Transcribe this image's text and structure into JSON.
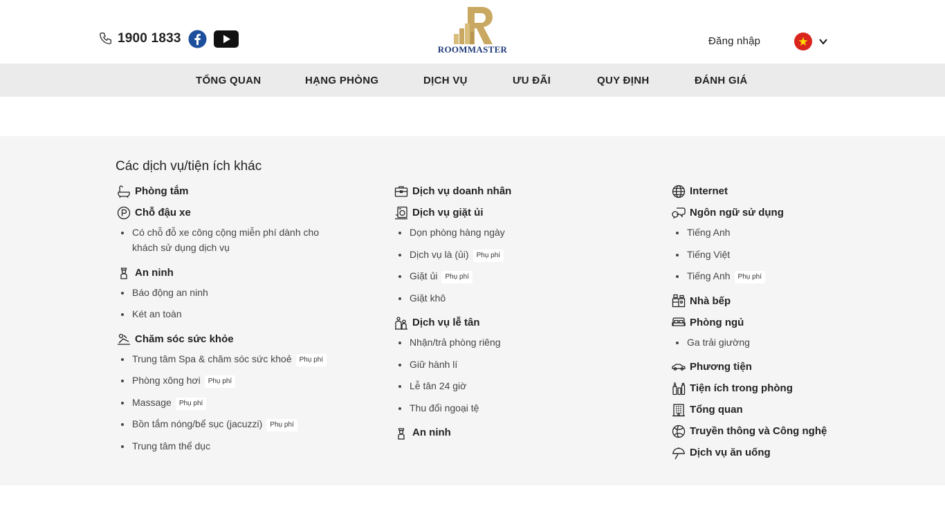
{
  "header": {
    "phone": "1900 1833",
    "brand": "ROOMMASTER",
    "login_label": "Đăng nhập",
    "language_icon": "vietnam-flag-icon",
    "brand_color": "#c9a961",
    "logo_text_color": "#1e3a78"
  },
  "nav": {
    "items": [
      {
        "label": "TỔNG QUAN"
      },
      {
        "label": "HẠNG PHÒNG"
      },
      {
        "label": "DỊCH VỤ"
      },
      {
        "label": "ƯU ĐÃI"
      },
      {
        "label": "QUY ĐỊNH"
      },
      {
        "label": "ĐÁNH GIÁ"
      }
    ]
  },
  "amenities": {
    "title": "Các dịch vụ/tiện ích khác",
    "fee_badge": "Phụ phí",
    "col1": {
      "bathroom": "Phòng tắm",
      "parking": "Chỗ đậu xe",
      "parking_items": [
        "Có chỗ đỗ xe công cộng miễn phí dành cho khách sử dụng dịch vụ"
      ],
      "security": "An ninh",
      "security_items": [
        "Báo động an ninh",
        "Két an toàn"
      ],
      "health": "Chăm sóc sức khỏe",
      "health_items": [
        "Trung tâm Spa & chăm sóc sức khoẻ",
        "Phòng xông hơi",
        "Massage",
        "Bồn tắm nóng/bể sục (jacuzzi)",
        "Trung tâm thể dục"
      ]
    },
    "col2": {
      "business": "Dịch vụ doanh nhân",
      "laundry": "Dịch vụ giặt ủi",
      "laundry_items": [
        "Dọn phòng hàng ngày",
        "Dịch vụ là (ủi)",
        "Giặt ủi",
        "Giặt khô"
      ],
      "reception": "Dịch vụ lễ tân",
      "reception_items": [
        "Nhận/trả phòng riêng",
        "Giữ hành lí",
        "Lễ tân 24 giờ",
        "Thu đổi ngoại tệ"
      ],
      "security": "An ninh"
    },
    "col3": {
      "internet": "Internet",
      "languages": "Ngôn ngữ sử dụng",
      "language_items": [
        "Tiếng Anh",
        "Tiếng Việt",
        "Tiếng Anh"
      ],
      "kitchen": "Nhà bếp",
      "bedroom": "Phòng ngủ",
      "bedroom_items": [
        "Ga trải giường"
      ],
      "transport": "Phương tiện",
      "room_amenities": "Tiện ích trong phòng",
      "overview": "Tổng quan",
      "media": "Truyền thông và Công nghệ",
      "dining": "Dịch vụ ăn uống"
    }
  }
}
